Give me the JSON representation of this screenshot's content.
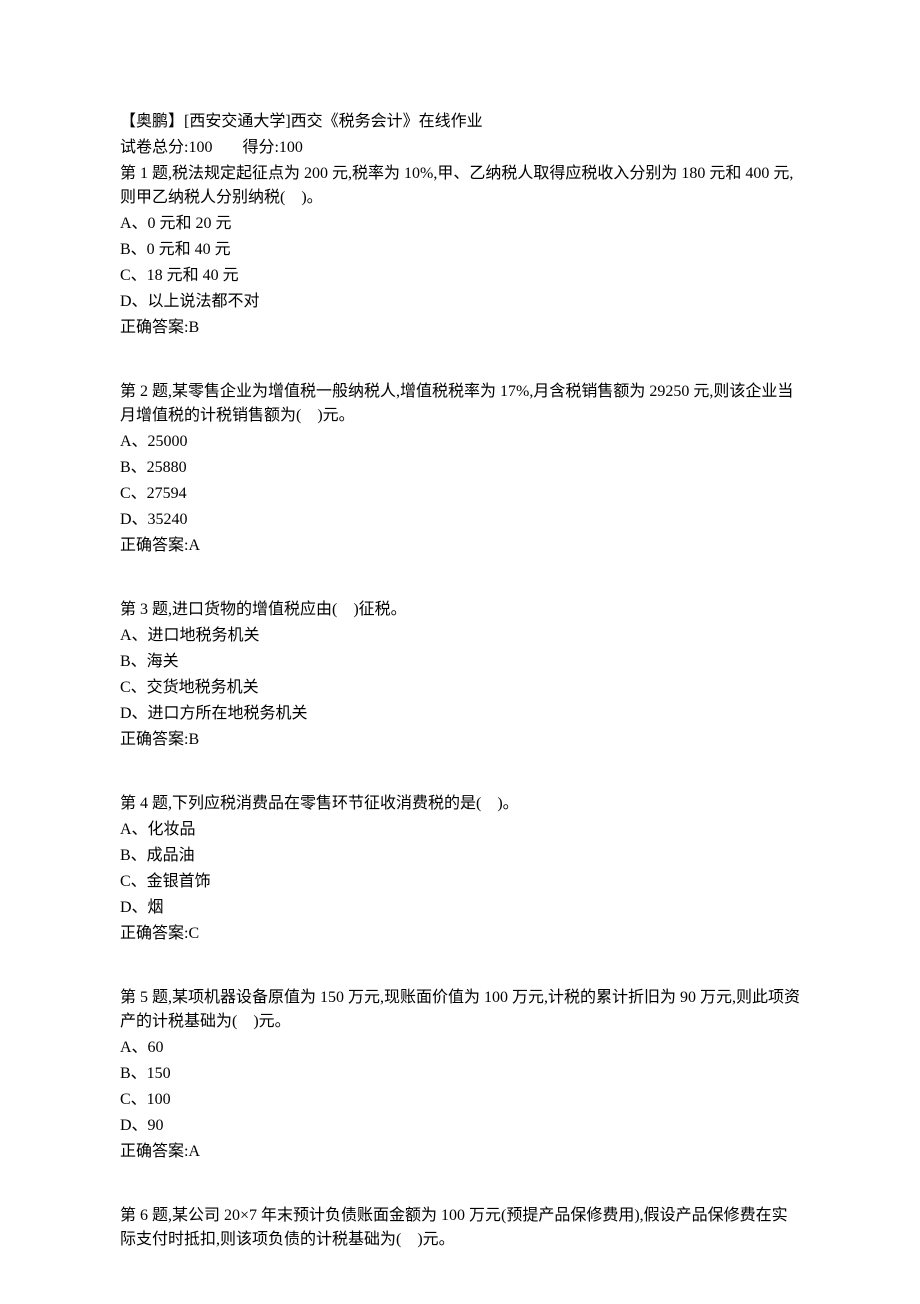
{
  "header": {
    "title": "【奥鹏】[西安交通大学]西交《税务会计》在线作业",
    "total_label": "试卷总分:",
    "total_value": "100",
    "score_label": "得分:",
    "score_value": "100"
  },
  "questions": [
    {
      "prompt": "第 1 题,税法规定起征点为 200 元,税率为 10%,甲、乙纳税人取得应税收入分别为 180 元和 400 元,则甲乙纳税人分别纳税(　)。",
      "options": [
        "A、0 元和 20 元",
        "B、0 元和 40 元",
        "C、18 元和 40 元",
        "D、以上说法都不对"
      ],
      "answer": "正确答案:B"
    },
    {
      "prompt": "第 2 题,某零售企业为增值税一般纳税人,增值税税率为 17%,月含税销售额为 29250 元,则该企业当月增值税的计税销售额为(　)元。",
      "options": [
        "A、25000",
        "B、25880",
        "C、27594",
        "D、35240"
      ],
      "answer": "正确答案:A"
    },
    {
      "prompt": "第 3 题,进口货物的增值税应由(　)征税。",
      "options": [
        "A、进口地税务机关",
        "B、海关",
        "C、交货地税务机关",
        "D、进口方所在地税务机关"
      ],
      "answer": "正确答案:B"
    },
    {
      "prompt": "第 4 题,下列应税消费品在零售环节征收消费税的是(　)。",
      "options": [
        "A、化妆品",
        "B、成品油",
        "C、金银首饰",
        "D、烟"
      ],
      "answer": "正确答案:C"
    },
    {
      "prompt": "第 5 题,某项机器设备原值为 150 万元,现账面价值为 100 万元,计税的累计折旧为 90 万元,则此项资产的计税基础为(　)元。",
      "options": [
        "A、60",
        "B、150",
        "C、100",
        "D、90"
      ],
      "answer": "正确答案:A"
    },
    {
      "prompt": "第 6 题,某公司 20×7 年末预计负债账面金额为 100 万元(预提产品保修费用),假设产品保修费在实际支付时抵扣,则该项负债的计税基础为(　)元。",
      "options": [],
      "answer": ""
    }
  ]
}
